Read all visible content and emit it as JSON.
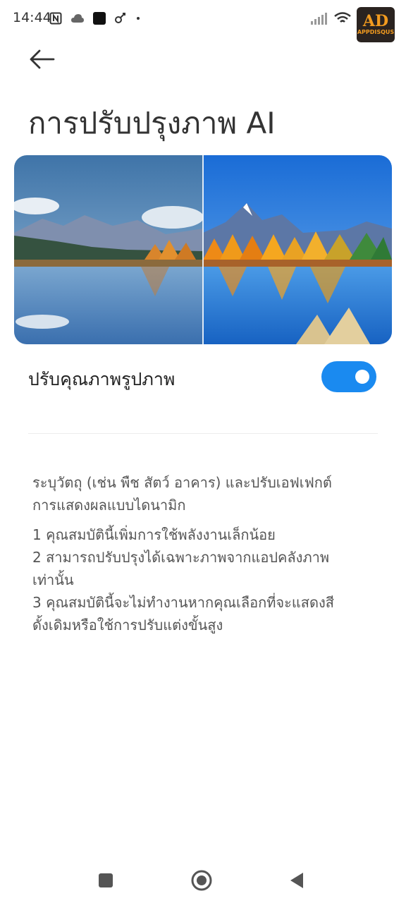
{
  "status_bar": {
    "time": "14:44",
    "left_icons": [
      "nfc-icon",
      "cloud-icon",
      "app-square-icon",
      "connect-icon",
      "dot-icon"
    ],
    "right_icons": [
      "signal-icon",
      "wifi-icon"
    ]
  },
  "watermark": {
    "top": "AD",
    "bottom": "APPDISQUS"
  },
  "header": {
    "back_icon": "arrow-left-icon",
    "title": "การปรับปรุงภาพ AI"
  },
  "toggle": {
    "label": "ปรับคุณภาพรูปภาพ",
    "enabled": true,
    "color": "#1a8af0"
  },
  "description": {
    "intro": [
      "ระบุวัตถุ (เช่น พืช สัตว์ อาคาร) และปรับเอฟเฟกต์",
      "การแสดงผลแบบไดนามิก"
    ],
    "notes": [
      "1 คุณสมบัตินี้เพิ่มการใช้พลังงานเล็กน้อย",
      "2 สามารถปรับปรุงได้เฉพาะภาพจากแอปคลังภาพ",
      "เท่านั้น",
      "3 คุณสมบัตินี้จะไม่ทำงานหากคุณเลือกที่จะแสดงสี",
      "ดั้งเดิมหรือใช้การปรับแต่งขั้นสูง"
    ]
  },
  "nav_bar": {
    "icons": [
      "recents-square-icon",
      "home-circle-icon",
      "back-triangle-icon"
    ]
  }
}
